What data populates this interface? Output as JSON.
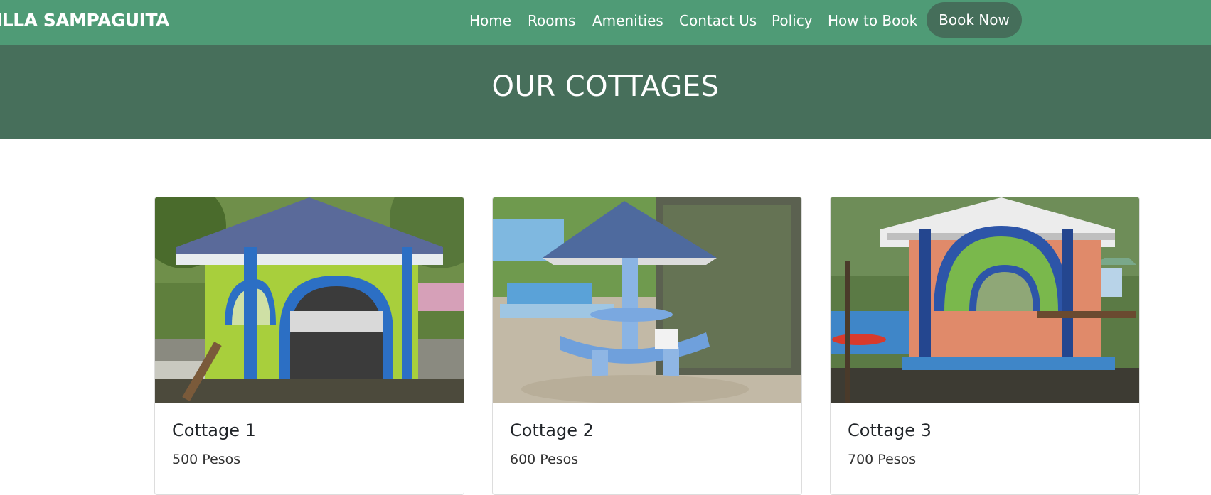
{
  "brand": {
    "name": "ILLA SAMPAGUITA"
  },
  "nav": {
    "items": [
      {
        "label": "Home"
      },
      {
        "label": "Rooms"
      },
      {
        "label": "Amenities"
      },
      {
        "label": "Contact Us"
      },
      {
        "label": "Policy"
      },
      {
        "label": "How to Book"
      }
    ],
    "cta_label": "Book Now"
  },
  "hero": {
    "title": "OUR COTTAGES"
  },
  "cottages": [
    {
      "name": "Cottage 1",
      "price": "500 Pesos",
      "image_icon": "cottage-1-photo"
    },
    {
      "name": "Cottage 2",
      "price": "600 Pesos",
      "image_icon": "cottage-2-photo"
    },
    {
      "name": "Cottage 3",
      "price": "700 Pesos",
      "image_icon": "cottage-3-photo"
    }
  ],
  "colors": {
    "navbar": "#4f9b76",
    "hero": "#476f5b",
    "cta_button": "#456e5a"
  }
}
